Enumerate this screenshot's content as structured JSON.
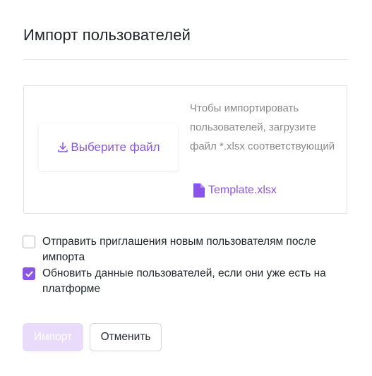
{
  "dialog": {
    "title": "Импорт пользователей"
  },
  "upload": {
    "pick_file_label": "Выберите файл",
    "hint_text": "Чтобы импортировать пользователей, загрузите файл *.xlsx соответствующий",
    "template_link_label": "Template.xlsx",
    "icons": {
      "pick_file": "download-icon",
      "template": "file-icon"
    }
  },
  "options": [
    {
      "label": "Отправить приглашения новым пользователям после импорта",
      "checked": false
    },
    {
      "label": "Обновить данные пользователей, если они уже есть на платформе",
      "checked": true
    }
  ],
  "actions": {
    "import_label": "Импорт",
    "cancel_label": "Отменить",
    "import_disabled": true
  },
  "colors": {
    "accent": "#8a55e6",
    "accent_disabled": "#e9dcfb",
    "hint_text": "#8a8a8a",
    "border": "#e2e2e2"
  }
}
